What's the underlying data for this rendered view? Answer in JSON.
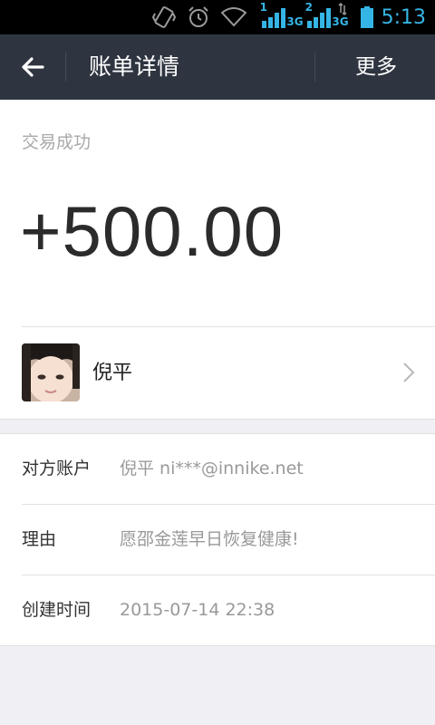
{
  "status_bar": {
    "time": "5:13",
    "sim1_label": "1",
    "sim1_network": "3G",
    "sim2_label": "2",
    "sim2_network": "3G",
    "accent_color": "#35b5e5",
    "icons": [
      "vibrate-icon",
      "alarm-icon",
      "wifi-icon",
      "signal-icon",
      "data-arrows-icon",
      "battery-icon"
    ]
  },
  "navbar": {
    "title": "账单详情",
    "more_label": "更多",
    "back_icon": "arrow-left-icon",
    "background": "#2e3440"
  },
  "transaction": {
    "status": "交易成功",
    "amount": "+500.00"
  },
  "counterparty": {
    "name": "倪平",
    "avatar_icon": "avatar-photo"
  },
  "details": [
    {
      "label": "对方账户",
      "value": "倪平 ni***@innike.net"
    },
    {
      "label": "理由",
      "value": "愿邵金莲早日恢复健康!"
    },
    {
      "label": "创建时间",
      "value": "2015-07-14 22:38"
    }
  ]
}
